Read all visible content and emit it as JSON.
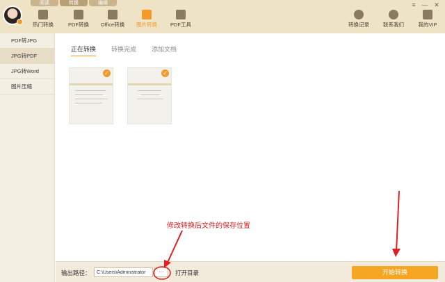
{
  "modes": [
    "阅读",
    "转换",
    "编辑"
  ],
  "toolbar": {
    "tools": [
      {
        "label": "热门转换",
        "icon": "star-icon"
      },
      {
        "label": "PDF转换",
        "icon": "pdf-icon"
      },
      {
        "label": "Office转换",
        "icon": "office-icon"
      },
      {
        "label": "图片转换",
        "icon": "image-icon"
      },
      {
        "label": "PDF工具",
        "icon": "toolbox-icon"
      }
    ],
    "right_tools": [
      {
        "label": "转换记录",
        "icon": "clock-icon"
      },
      {
        "label": "联系我们",
        "icon": "headset-icon"
      },
      {
        "label": "我的VIP",
        "icon": "crown-icon"
      }
    ],
    "window": {
      "menu": "≡",
      "minimize": "—",
      "close": "✕"
    }
  },
  "sidebar": {
    "items": [
      "PDF转JPG",
      "JPG转PDF",
      "JPG转Word",
      "图片压缩"
    ]
  },
  "tabs": [
    "正在转换",
    "转换完成",
    "添加文档"
  ],
  "thumbnails": [
    {
      "check": "✓"
    },
    {
      "check": "✓"
    }
  ],
  "bottom": {
    "output_label": "输出路径：",
    "path_value": "C:\\Users\\Administrator",
    "browse": "···",
    "open_dir": "打开目录",
    "start": "开始转换"
  },
  "annotation": {
    "text": "修改转换后文件的保存位置",
    "color": "#e02020"
  },
  "colors": {
    "accent": "#f39a2a",
    "topbar": "#efe3c6"
  }
}
